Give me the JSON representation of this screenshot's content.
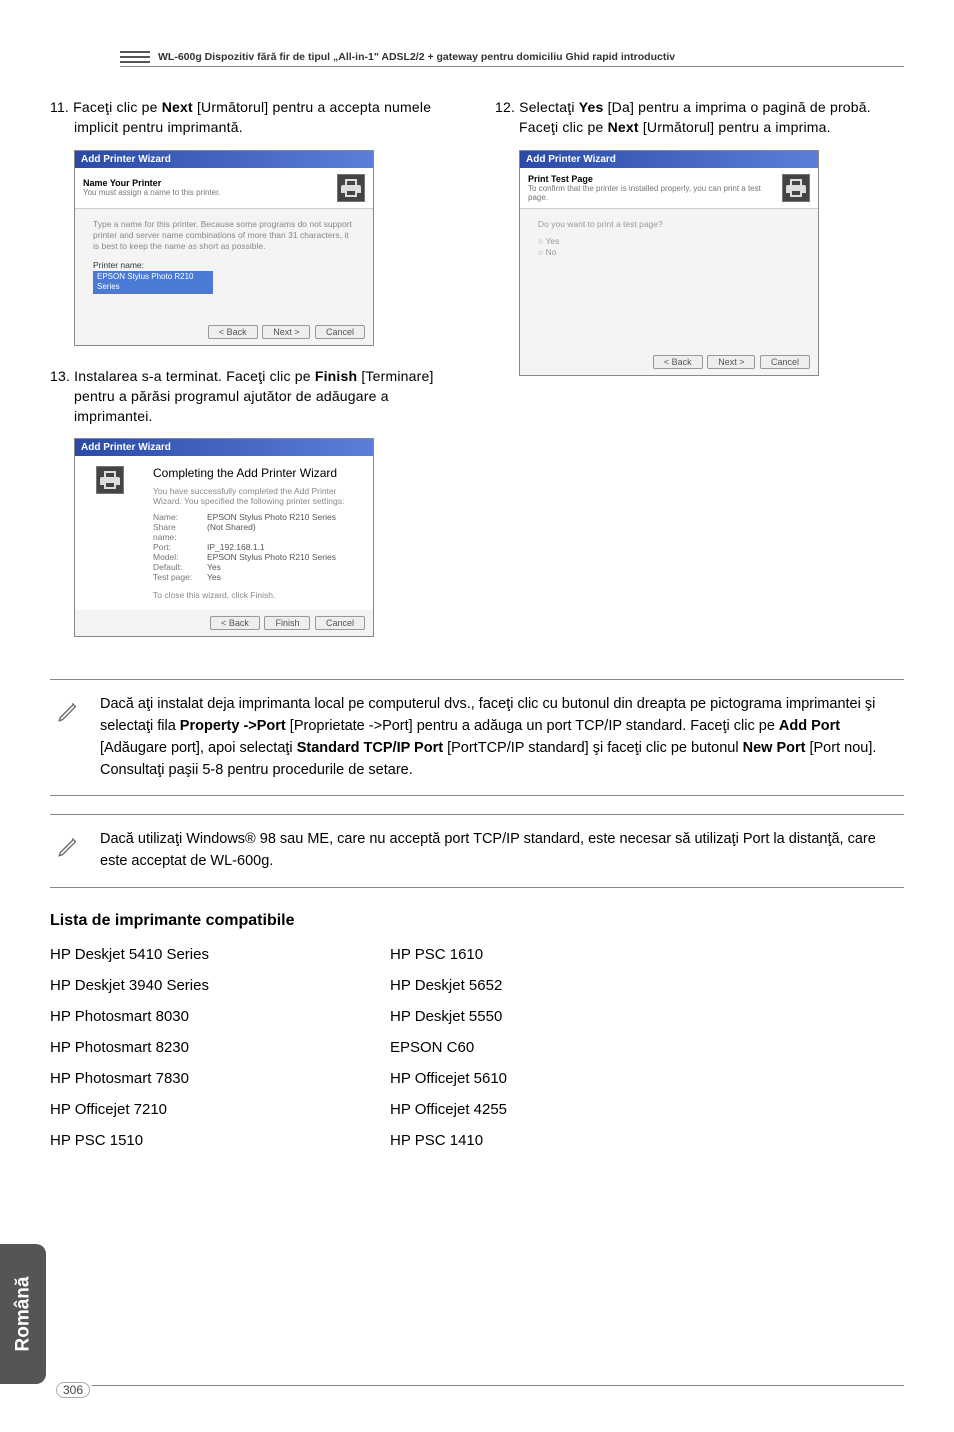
{
  "header": {
    "text": "WL-600g Dispozitiv fără fir de tipul „All-in-1\" ADSL2/2 + gateway pentru domiciliu Ghid rapid introductiv"
  },
  "step11": {
    "num": "11.",
    "text_a": "Faceţi clic pe ",
    "bold_a": "Next",
    "text_b": " [Următorul] pentru a accepta numele implicit pentru imprimantă."
  },
  "step12": {
    "num": "12.",
    "text_a": "Selectaţi ",
    "bold_a": "Yes",
    "text_b": " [Da] pentru a imprima o pagină de probă. Faceţi clic pe ",
    "bold_b": "Next",
    "text_c": " [Următorul] pentru a imprima."
  },
  "step13": {
    "num": "13.",
    "text_a": "Instalarea s-a terminat. Faceţi clic pe ",
    "bold_a": "Finish",
    "text_b": " [Terminare] pentru a părăsi programul ajutător de adăugare a imprimantei."
  },
  "dialog1": {
    "title": "Add Printer Wizard",
    "hdr_t1": "Name Your Printer",
    "hdr_t2": "You must assign a name to this printer.",
    "desc": "Type a name for this printer. Because some programs do not support printer and server name combinations of more than 31 characters, it is best to keep the name as short as possible.",
    "lbl": "Printer name:",
    "field": "EPSON Stylus Photo R210 Series",
    "back": "< Back",
    "next": "Next >",
    "cancel": "Cancel"
  },
  "dialog2": {
    "title": "Add Printer Wizard",
    "hdr_t1": "Print Test Page",
    "hdr_t2": "To confirm that the printer is installed properly, you can print a test page.",
    "desc": "Do you want to print a test page?",
    "opt_yes": "Yes",
    "opt_no": "No",
    "back": "< Back",
    "next": "Next >",
    "cancel": "Cancel"
  },
  "dialog3": {
    "title": "Add Printer Wizard",
    "ctitle": "Completing the Add Printer Wizard",
    "sub": "You have successfully completed the Add Printer Wizard. You specified the following printer settings:",
    "rows": [
      {
        "k": "Name:",
        "v": "EPSON Stylus Photo R210 Series"
      },
      {
        "k": "Share name:",
        "v": "(Not Shared)"
      },
      {
        "k": "Port:",
        "v": "IP_192.168.1.1"
      },
      {
        "k": "Model:",
        "v": "EPSON Stylus Photo R210 Series"
      },
      {
        "k": "Default:",
        "v": "Yes"
      },
      {
        "k": "Test page:",
        "v": "Yes"
      }
    ],
    "closing": "To close this wizard, click Finish.",
    "back": "< Back",
    "finish": "Finish",
    "cancel": "Cancel"
  },
  "note1": {
    "t1": "Dacă aţi instalat deja imprimanta local pe computerul dvs., faceţi clic cu butonul din dreapta pe pictograma imprimantei şi selectaţi fila ",
    "b1": "Property ->Port",
    "t2": " [Proprietate ->Port] pentru a adăuga un port TCP/IP standard. Faceţi clic pe ",
    "b2": "Add Port",
    "t3": " [Adăugare port], apoi selectaţi ",
    "b3": "Standard TCP/IP Port",
    "t4": " [PortTCP/IP standard] şi faceţi clic pe butonul ",
    "b4": "New Port",
    "t5": " [Port nou]. Consultaţi paşii 5-8 pentru procedurile de setare."
  },
  "note2": {
    "t1": "Dacă utilizaţi Windows® 98 sau ME, care nu acceptă port TCP/IP standard, este necesar să utilizaţi Port la distanţă, care este acceptat de WL-600g."
  },
  "list_title": "Lista de imprimante compatibile",
  "printers_left": [
    "HP Deskjet 5410 Series",
    "HP Deskjet 3940 Series",
    "HP Photosmart 8030",
    "HP Photosmart 8230",
    "HP Photosmart 7830",
    "HP Officejet  7210",
    "HP PSC 1510"
  ],
  "printers_right": [
    "HP PSC 1610",
    "HP Deskjet 5652",
    "HP Deskjet 5550",
    "EPSON C60",
    "HP Officejet 5610",
    "HP Officejet 4255",
    "HP PSC 1410"
  ],
  "side_tab": "Română",
  "page_num": "306"
}
